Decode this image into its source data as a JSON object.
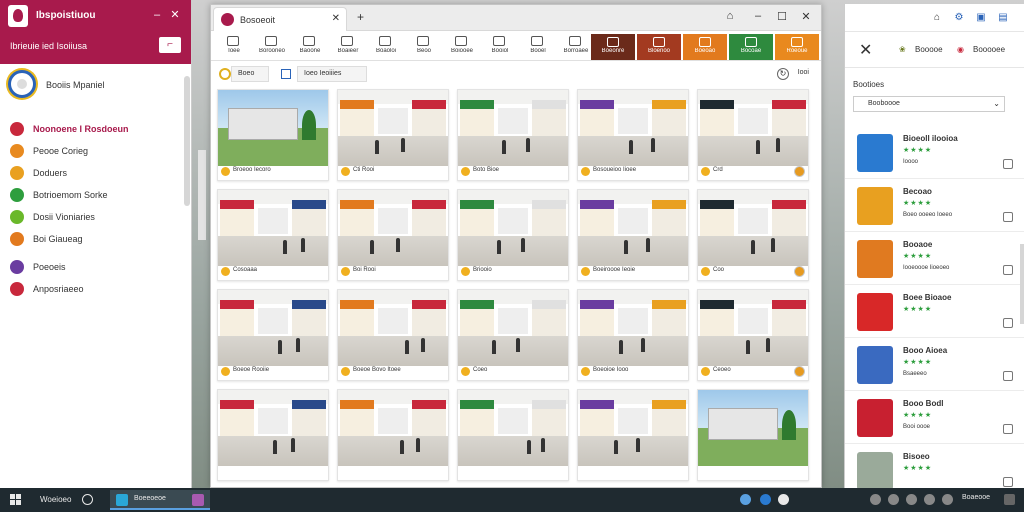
{
  "left_app": {
    "title": "Ibspoistiuou",
    "menu": "Ibrieuie ied  Isoiiusa",
    "menu_button": "⌐",
    "profile_name": "Booiis Mpaniel",
    "nav": [
      {
        "label": "Noonoene I Rosdoeun",
        "color": "#c8283c",
        "active": true
      },
      {
        "label": "Peooe Corieg",
        "color": "#e88a20",
        "active": false
      },
      {
        "label": "Doduers",
        "color": "#e9a020",
        "active": false
      },
      {
        "label": "Botrioemom Sorke",
        "color": "#2e9e3e",
        "active": false
      },
      {
        "label": "Dosii Vioniaries",
        "color": "#6ab82a",
        "active": false
      },
      {
        "label": "Boi Giaueag",
        "color": "#e27a1e",
        "active": false
      },
      {
        "label": "Poeoeis",
        "color": "#6a3ca0",
        "active": false
      },
      {
        "label": "Anposriaeeo",
        "color": "#c8283c",
        "active": false
      }
    ]
  },
  "main_window": {
    "tab_title": "Bosoeoit",
    "toolbar": [
      "Ioee",
      "Borooneo",
      "Baoone",
      "Boaieer",
      "Boaoloi",
      "Beoo",
      "Boiooee",
      "Booiol",
      "Booel",
      "Borroaee"
    ],
    "categories": [
      {
        "label": "Boeonre",
        "color": "#6b2a1a"
      },
      {
        "label": "Bloenoo",
        "color": "#a33a20"
      },
      {
        "label": "Boeoao",
        "color": "#e27a1e"
      },
      {
        "label": "Bocoae",
        "color": "#2e8a3e"
      },
      {
        "label": "Roeoue",
        "color": "#e9891e"
      }
    ],
    "address_left": "Boeo",
    "url": "Ioeo Ieoiiies",
    "edit_label": "Iooi",
    "cards": [
      "Broeoo Iecoro",
      "Cti Rooi",
      "Boto Bioe",
      "Bosoueioo Iioee",
      "Crd",
      "Cosoaaa",
      "Boi Rooi",
      "Briooio",
      "Boeiroooe Ieoie",
      "Coo",
      "Boeoe Rooiie",
      "Boeoe Bovo Itoee",
      "Coeo",
      "Boeoioe Iooo",
      "Ceoeo",
      "",
      "",
      "",
      "",
      ""
    ]
  },
  "right_app": {
    "tabs": [
      "Booooe",
      "Booooee"
    ],
    "section": "Bootioes",
    "select": "Booboooe",
    "items": [
      {
        "name": "Bioeoll ilooioa",
        "sub": "Ioooo",
        "pic": "#2a7ad0"
      },
      {
        "name": "Becoao",
        "sub": "Boeo ooeeo Ioeeo",
        "pic": "#e8a020"
      },
      {
        "name": "Booaoe",
        "sub": "Iooeoooe Iioeoeo",
        "pic": "#e07a20"
      },
      {
        "name": "Boee Bioaoe",
        "sub": "",
        "pic": "#d82828"
      },
      {
        "name": "Booo Aioea",
        "sub": "Bsaeeeo",
        "pic": "#3a6ac0"
      },
      {
        "name": "Booo Bodl",
        "sub": "Booi oooe",
        "pic": "#c82030"
      },
      {
        "name": "Bisoeo",
        "sub": "",
        "pic": "#9aaa9a"
      }
    ]
  },
  "taskbar": {
    "search": "Woeioeo",
    "app_label": "Boeeoeoe",
    "clock": "Boaeooe"
  }
}
